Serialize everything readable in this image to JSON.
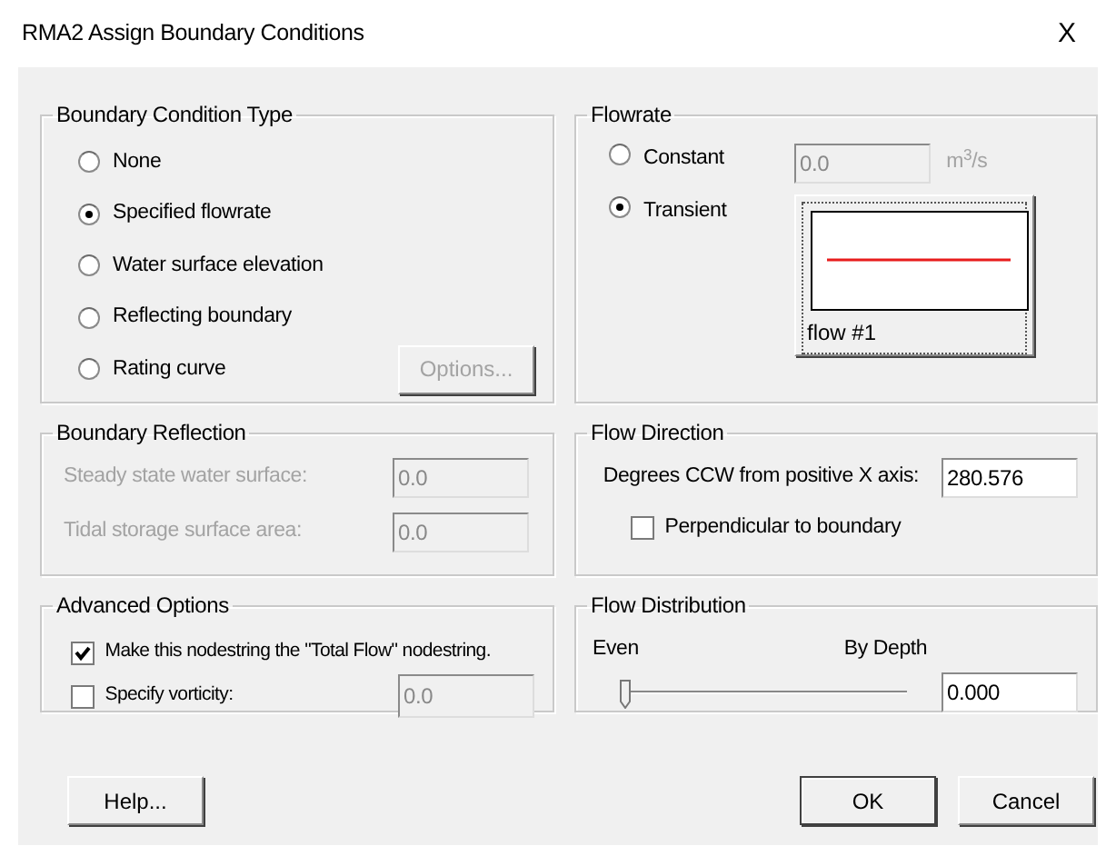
{
  "window": {
    "title": "RMA2 Assign Boundary Conditions",
    "close": "X"
  },
  "boundary_condition_type": {
    "title": "Boundary Condition Type",
    "options": [
      {
        "label": "None",
        "selected": false
      },
      {
        "label": "Specified flowrate",
        "selected": true
      },
      {
        "label": "Water surface elevation",
        "selected": false
      },
      {
        "label": "Reflecting boundary",
        "selected": false
      },
      {
        "label": "Rating curve",
        "selected": false
      }
    ],
    "options_button": {
      "label": "Options...",
      "disabled": true
    }
  },
  "flowrate": {
    "title": "Flowrate",
    "modes": [
      {
        "label": "Constant",
        "selected": false
      },
      {
        "label": "Transient",
        "selected": true
      }
    ],
    "value": "0.0",
    "value_disabled": true,
    "unit": "m$^{3}$/s",
    "curve_button": {
      "label": "flow #1"
    }
  },
  "boundary_reflection": {
    "title": "Boundary Reflection",
    "disabled": true,
    "fields": [
      {
        "label": "Steady state water surface:",
        "value": "0.0"
      },
      {
        "label": "Tidal storage surface area:",
        "value": "0.0"
      }
    ]
  },
  "flow_direction": {
    "title": "Flow Direction",
    "label": "Degrees CCW from positive X axis:",
    "value": "280.576",
    "perpendicular": {
      "label": "Perpendicular to boundary",
      "checked": false
    }
  },
  "advanced_options": {
    "title": "Advanced Options",
    "items": [
      {
        "kind": "checkbox",
        "label": "Make this nodestring the \"Total Flow\" nodestring.",
        "checked": true
      },
      {
        "kind": "checkbox-field",
        "label": "Specify vorticity:",
        "checked": false,
        "value": "0.0",
        "value_disabled": true
      }
    ]
  },
  "flow_distribution": {
    "title": "Flow Distribution",
    "min_label": "Even",
    "max_label": "By Depth",
    "level": 0,
    "value": "0.000"
  },
  "buttons": [
    {
      "label": "Help...",
      "default": false
    },
    {
      "label": "OK",
      "default": true
    },
    {
      "label": "Cancel",
      "default": false
    }
  ]
}
